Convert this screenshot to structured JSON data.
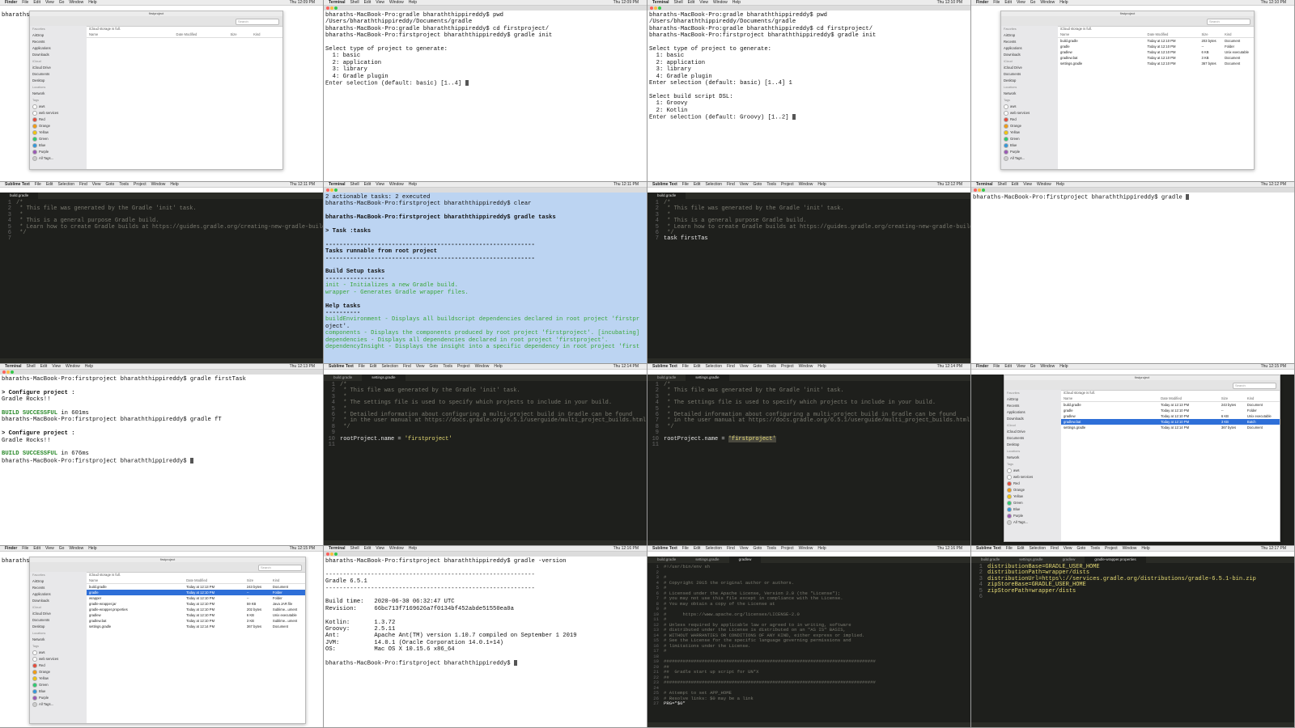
{
  "menubar": {
    "finder": {
      "app": "Finder",
      "items": [
        "File",
        "Edit",
        "View",
        "Go",
        "Window",
        "Help"
      ]
    },
    "terminal": {
      "app": "Terminal",
      "items": [
        "Shell",
        "Edit",
        "View",
        "Window",
        "Help"
      ]
    },
    "sublime": {
      "app": "Sublime Text",
      "items": [
        "File",
        "Edit",
        "Selection",
        "Find",
        "View",
        "Goto",
        "Tools",
        "Project",
        "Window",
        "Help"
      ]
    }
  },
  "panels": {
    "p1": {
      "clock": "Thu 12:09 PM",
      "user_text": "bharaths",
      "window_title": "firstproject",
      "search": "Search"
    },
    "p2": {
      "clock": "Thu 12:09 PM",
      "lines": [
        "bharaths-MacBook-Pro:gradle bharaththippireddy$ pwd",
        "/Users/bharaththippireddy/Documents/gradle",
        "bharaths-MacBook-Pro:gradle bharaththippireddy$ cd firstproject/",
        "bharaths-MacBook-Pro:firstproject bharaththippireddy$ gradle init",
        "",
        "Select type of project to generate:",
        "  1: basic",
        "  2: application",
        "  3: library",
        "  4: Gradle plugin",
        "Enter selection (default: basic) [1..4] "
      ]
    },
    "p3": {
      "clock": "Thu 12:10 PM",
      "lines": [
        "bharaths-MacBook-Pro:gradle bharaththippireddy$ pwd",
        "/Users/bharaththippireddy/Documents/gradle",
        "bharaths-MacBook-Pro:gradle bharaththippireddy$ cd firstproject/",
        "bharaths-MacBook-Pro:firstproject bharaththippireddy$ gradle init",
        "",
        "Select type of project to generate:",
        "  1: basic",
        "  2: application",
        "  3: library",
        "  4: Gradle plugin",
        "Enter selection (default: basic) [1..4] 1",
        "",
        "Select build script DSL:",
        "  1: Groovy",
        "  2: Kotlin",
        "Enter selection (default: Groovy) [1..2] "
      ]
    },
    "p4": {
      "clock": "Thu 12:10 PM",
      "window_title": "firstproject",
      "files": [
        {
          "name": "build.gradle",
          "date": "Today at 12:10 PM",
          "size": "203 bytes",
          "kind": "Document"
        },
        {
          "name": "gradle",
          "date": "Today at 12:10 PM",
          "size": "--",
          "kind": "Folder"
        },
        {
          "name": "gradlew",
          "date": "Today at 12:10 PM",
          "size": "6 KB",
          "kind": "Unix executable"
        },
        {
          "name": "gradlew.bat",
          "date": "Today at 12:10 PM",
          "size": "3 KB",
          "kind": "Document"
        },
        {
          "name": "settings.gradle",
          "date": "Today at 12:10 PM",
          "size": "367 bytes",
          "kind": "Document"
        }
      ]
    },
    "p5": {
      "clock": "Thu 12:11 PM",
      "tab": "build.gradle",
      "lines": [
        "/*",
        " * This file was generated by the Gradle 'init' task.",
        " *",
        " * This is a general purpose Gradle build.",
        " * Learn how to create Gradle builds at https://guides.gradle.org/creating-new-gradle-builds",
        " */",
        ""
      ]
    },
    "p6": {
      "clock": "Thu 12:11 PM",
      "lines": [
        "2 actionable tasks: 2 executed",
        "bharaths-MacBook-Pro:firstproject bharaththippireddy$ clear",
        "",
        "bharaths-MacBook-Pro:firstproject bharaththippireddy$ gradle tasks",
        "",
        "> Task :tasks",
        "",
        "------------------------------------------------------------",
        "Tasks runnable from root project",
        "------------------------------------------------------------",
        "",
        "Build Setup tasks",
        "-----------------",
        "init - Initializes a new Gradle build.",
        "wrapper - Generates Gradle wrapper files.",
        "",
        "Help tasks",
        "----------",
        "buildEnvironment - Displays all buildscript dependencies declared in root project 'firstpr",
        "oject'.",
        "components - Displays the components produced by root project 'firstproject'. [incubating]",
        "dependencies - Displays all dependencies declared in root project 'firstproject'.",
        "dependencyInsight - Displays the insight into a specific dependency in root project 'first"
      ]
    },
    "p7": {
      "clock": "Thu 12:12 PM",
      "tab": "build.gradle",
      "lines": [
        "/*",
        " * This file was generated by the Gradle 'init' task.",
        " *",
        " * This is a general purpose Gradle build.",
        " * Learn how to create Gradle builds at https://guides.gradle.org/creating-new-gradle-builds",
        " */",
        "task firstTas"
      ]
    },
    "p8": {
      "clock": "Thu 12:12 PM",
      "lines": [
        "bharaths-MacBook-Pro:firstproject bharaththippireddy$ gradle "
      ]
    },
    "p9": {
      "clock": "Thu 12:13 PM",
      "lines": [
        "bharaths-MacBook-Pro:firstproject bharaththippireddy$ gradle firstTask",
        "",
        "> Configure project :",
        "Gradle Rocks!!",
        "",
        "BUILD SUCCESSFUL in 601ms",
        "bharaths-MacBook-Pro:firstproject bharaththippireddy$ gradle fT",
        "",
        "> Configure project :",
        "Gradle Rocks!!",
        "",
        "BUILD SUCCESSFUL in 676ms",
        "bharaths-MacBook-Pro:firstproject bharaththippireddy$ "
      ]
    },
    "p10": {
      "clock": "Thu 12:14 PM",
      "tabs": [
        "build.gradle",
        "settings.gradle"
      ],
      "lines": [
        "/*",
        " * This file was generated by the Gradle 'init' task.",
        " *",
        " * The settings file is used to specify which projects to include in your build.",
        " *",
        " * Detailed information about configuring a multi-project build in Gradle can be found",
        " * in the user manual at https://docs.gradle.org/6.5.1/userguide/multi_project_builds.html",
        " */",
        "",
        "rootProject.name = 'firstproject'",
        ""
      ]
    },
    "p11": {
      "clock": "Thu 12:14 PM",
      "tabs": [
        "build.gradle",
        "settings.gradle"
      ],
      "lines": [
        "/*",
        " * This file was generated by the Gradle 'init' task.",
        " *",
        " * The settings file is used to specify which projects to include in your build.",
        " *",
        " * Detailed information about configuring a multi-project build in Gradle can be found",
        " * in the user manual at https://docs.gradle.org/6.5.1/userguide/multi_project_builds.html",
        " */",
        "",
        "rootProject.name = 'firstproject'",
        ""
      ]
    },
    "p12": {
      "clock": "Thu 12:15 PM",
      "window_title": "firstproject",
      "files": [
        {
          "name": "build.gradle",
          "date": "Today at 12:13 PM",
          "size": "243 bytes",
          "kind": "Document"
        },
        {
          "name": "gradle",
          "date": "Today at 12:10 PM",
          "size": "--",
          "kind": "Folder"
        },
        {
          "name": "gradlew",
          "date": "Today at 12:10 PM",
          "size": "6 KB",
          "kind": "Unix executable"
        },
        {
          "name": "gradlew.bat",
          "date": "Today at 12:10 PM",
          "size": "3 KB",
          "kind": "Batch",
          "selected": true
        },
        {
          "name": "settings.gradle",
          "date": "Today at 12:14 PM",
          "size": "367 bytes",
          "kind": "Document"
        }
      ]
    },
    "p13": {
      "clock": "Thu 12:15 PM",
      "window_title": "firstproject",
      "files": [
        {
          "name": "build.gradle",
          "date": "Today at 12:13 PM",
          "size": "243 bytes",
          "kind": "Document"
        },
        {
          "name": "gradle",
          "date": "Today at 12:10 PM",
          "size": "--",
          "kind": "Folder",
          "selected": true
        },
        {
          "name": "wrapper",
          "date": "Today at 12:10 PM",
          "size": "--",
          "kind": "Folder"
        },
        {
          "name": "gradle-wrapper.jar",
          "date": "Today at 12:10 PM",
          "size": "59 KB",
          "kind": "Java JAR file"
        },
        {
          "name": "gradle-wrapper.properties",
          "date": "Today at 12:10 PM",
          "size": "202 bytes",
          "kind": "Sublime...ument"
        },
        {
          "name": "gradlew",
          "date": "Today at 12:10 PM",
          "size": "6 KB",
          "kind": "Unix executable"
        },
        {
          "name": "gradlew.bat",
          "date": "Today at 12:10 PM",
          "size": "3 KB",
          "kind": "Sublime...ument"
        },
        {
          "name": "settings.gradle",
          "date": "Today at 12:14 PM",
          "size": "367 bytes",
          "kind": "Document"
        }
      ]
    },
    "p14": {
      "clock": "Thu 12:16 PM",
      "lines": [
        "bharaths-MacBook-Pro:firstproject bharaththippireddy$ gradle -version",
        "",
        "------------------------------------------------------------",
        "Gradle 6.5.1",
        "------------------------------------------------------------",
        "",
        "Build time:   2020-06-30 06:32:47 UTC",
        "Revision:     66bc713f7169626a7f0134bf452abde51550ea0a",
        "",
        "Kotlin:       1.3.72",
        "Groovy:       2.5.11",
        "Ant:          Apache Ant(TM) version 1.10.7 compiled on September 1 2019",
        "JVM:          14.0.1 (Oracle Corporation 14.0.1+14)",
        "OS:           Mac OS X 10.15.6 x86_64",
        "",
        "bharaths-MacBook-Pro:firstproject bharaththippireddy$ "
      ]
    },
    "p15": {
      "clock": "Thu 12:16 PM",
      "tabs": [
        "build.gradle",
        "settings.gradle",
        "gradlew"
      ],
      "lines": [
        "#!/usr/bin/env sh",
        "",
        "#",
        "# Copyright 2015 the original author or authors.",
        "#",
        "# Licensed under the Apache License, Version 2.0 (the \"License\");",
        "# you may not use this file except in compliance with the License.",
        "# You may obtain a copy of the License at",
        "#",
        "#      https://www.apache.org/licenses/LICENSE-2.0",
        "#",
        "# Unless required by applicable law or agreed to in writing, software",
        "# distributed under the License is distributed on an \"AS IS\" BASIS,",
        "# WITHOUT WARRANTIES OR CONDITIONS OF ANY KIND, either express or implied.",
        "# See the License for the specific language governing permissions and",
        "# limitations under the License.",
        "#",
        "",
        "##############################################################################",
        "##",
        "##  Gradle start up script for UN*X",
        "##",
        "##############################################################################",
        "",
        "# Attempt to set APP_HOME",
        "# Resolve links: $0 may be a link",
        "PRG=\"$0\""
      ]
    },
    "p16": {
      "clock": "Thu 12:17 PM",
      "tabs": [
        "build.gradle",
        "settings.gradle",
        "gradlew",
        "gradle-wrapper.properties"
      ],
      "lines": [
        "distributionBase=GRADLE_USER_HOME",
        "distributionPath=wrapper/dists",
        "distributionUrl=https\\://services.gradle.org/distributions/gradle-6.5.1-bin.zip",
        "zipStoreBase=GRADLE_USER_HOME",
        "zipStorePath=wrapper/dists",
        ""
      ]
    }
  },
  "finder_sidebar": {
    "favorites_header": "Favorites",
    "favorites": [
      "AirDrop",
      "Recents",
      "Applications",
      "Downloads"
    ],
    "icloud_header": "iCloud",
    "icloud": [
      "iCloud Drive",
      "Documents",
      "Desktop"
    ],
    "locations_header": "Locations",
    "locations": [
      "Network"
    ],
    "tags_header": "Tags",
    "tags": [
      {
        "name": "aws",
        "color": "#ffffff"
      },
      {
        "name": "web services",
        "color": "#ffffff"
      },
      {
        "name": "Red",
        "color": "#e74c3c"
      },
      {
        "name": "Orange",
        "color": "#f39c12"
      },
      {
        "name": "Yellow",
        "color": "#f1c40f"
      },
      {
        "name": "Green",
        "color": "#2ecc71"
      },
      {
        "name": "Blue",
        "color": "#3498db"
      },
      {
        "name": "Purple",
        "color": "#9b59b6"
      },
      {
        "name": "All Tags...",
        "color": "#cccccc"
      }
    ]
  },
  "finder_columns": [
    "Name",
    "Date Modified",
    "Size",
    "Kind"
  ],
  "icloud_banner": "iCloud storage is full.",
  "icloud_buttons": [
    "Upgrade...",
    "Learn More..."
  ],
  "colors": {
    "terminal_select": "#b5d1f5",
    "finder_select": "#2e6fd8",
    "editor_bg": "#1e1f1c"
  }
}
